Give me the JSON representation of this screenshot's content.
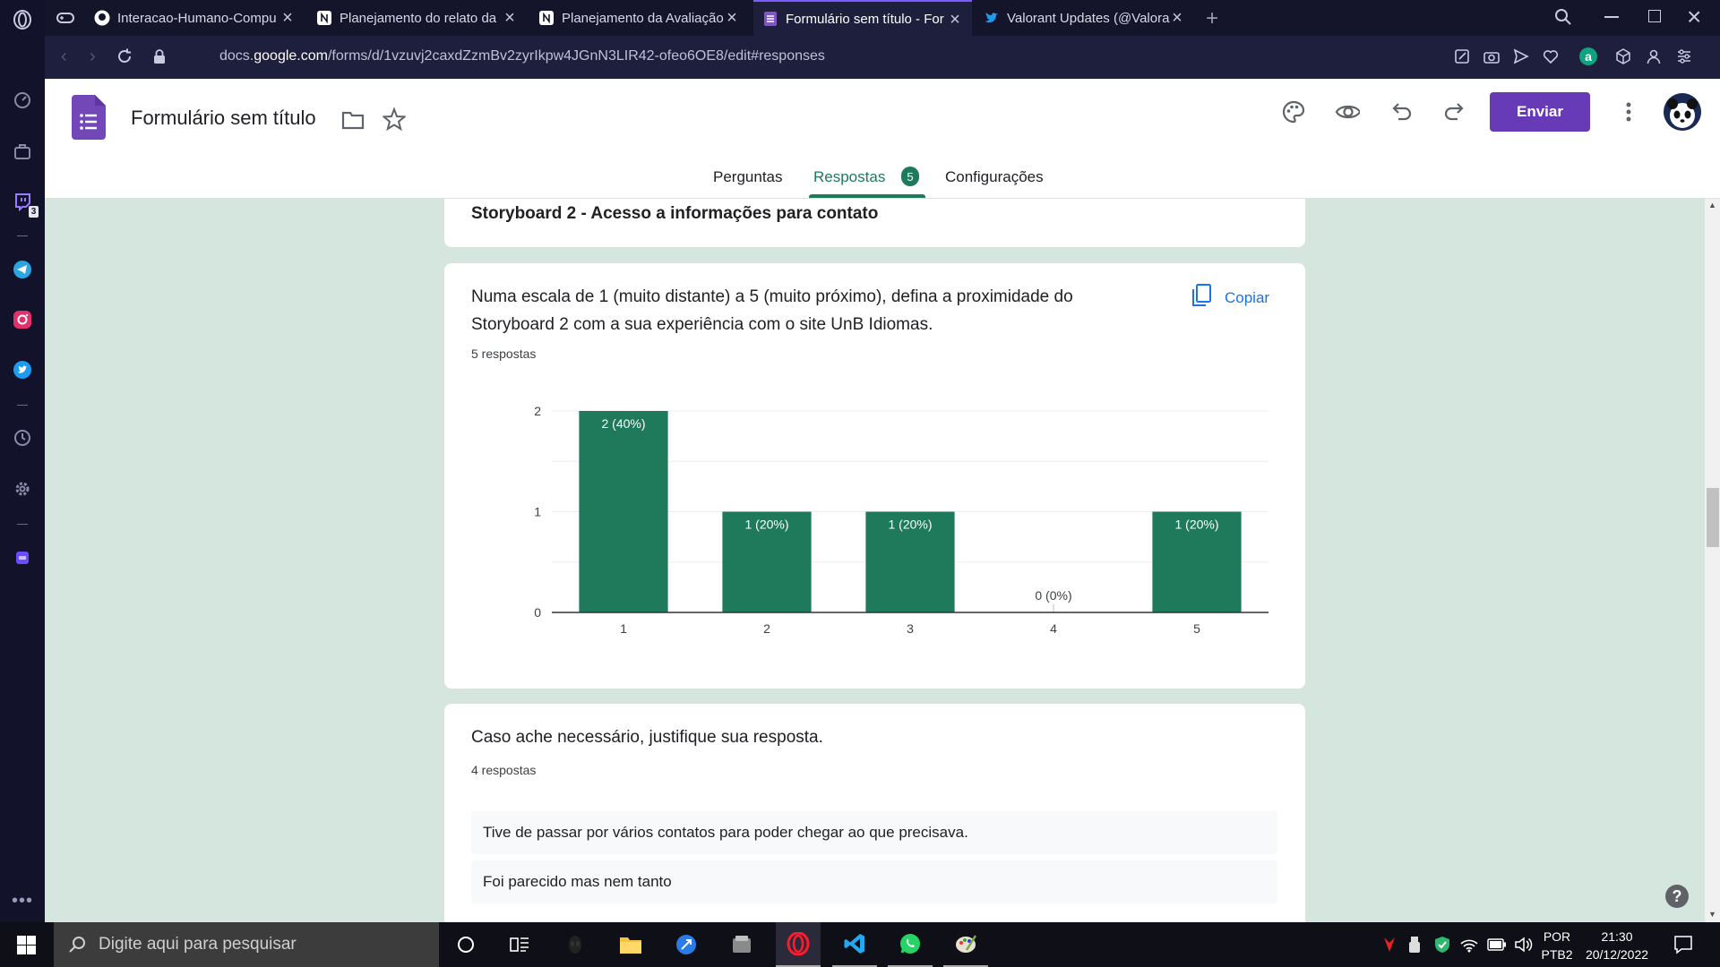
{
  "browser": {
    "tabs": [
      {
        "title": "Interacao-Humano-Compu",
        "favicon": "github-icon"
      },
      {
        "title": "Planejamento do relato da",
        "favicon": "notion-icon"
      },
      {
        "title": "Planejamento da Avaliação",
        "favicon": "notion-icon"
      },
      {
        "title": "Formulário sem título - For",
        "favicon": "forms-icon",
        "active": true
      },
      {
        "title": "Valorant Updates (@Valora",
        "favicon": "twitter-icon"
      }
    ],
    "url_prefix": "docs.",
    "url_domain": "google.com",
    "url_path": "/forms/d/1vzuvj2caxdZzmBv2zyrIkpw4JGnN3LIR42-ofeo6OE8/edit#responses",
    "sidebar_badge": "3"
  },
  "form": {
    "title": "Formulário sem título",
    "send_label": "Enviar",
    "nav": {
      "questions": "Perguntas",
      "responses": "Respostas",
      "responses_count": "5",
      "settings": "Configurações"
    },
    "accent_color": "#673ab7",
    "theme_color": "#1e7a5a"
  },
  "section_title": "Storyboard 2 - Acesso a informações para contato",
  "question1": {
    "text_line1": "Numa escala de 1 (muito distante) a 5 (muito próximo), defina a proximidade do",
    "text_line2": "Storyboard 2 com a sua experiência com o site UnB Idiomas.",
    "count": "5 respostas",
    "copy_label": "Copiar"
  },
  "chart_data": {
    "type": "bar",
    "categories": [
      "1",
      "2",
      "3",
      "4",
      "5"
    ],
    "values": [
      2,
      1,
      1,
      0,
      1
    ],
    "data_labels": [
      "2 (40%)",
      "1 (20%)",
      "1 (20%)",
      "0 (0%)",
      "1 (20%)"
    ],
    "yticks": [
      "0",
      "1",
      "2"
    ],
    "ylim": [
      0,
      2
    ],
    "grid": true,
    "bar_color": "#1e7a5a"
  },
  "question2": {
    "text": "Caso ache necessário, justifique sua resposta.",
    "count": "4 respostas",
    "answers": [
      "Tive de passar por vários contatos para poder chegar ao que precisava.",
      "Foi parecido mas nem tanto"
    ]
  },
  "taskbar": {
    "search_placeholder": "Digite aqui para pesquisar",
    "lang_line1": "POR",
    "lang_line2": "PTB2",
    "time": "21:30",
    "date": "20/12/2022"
  }
}
